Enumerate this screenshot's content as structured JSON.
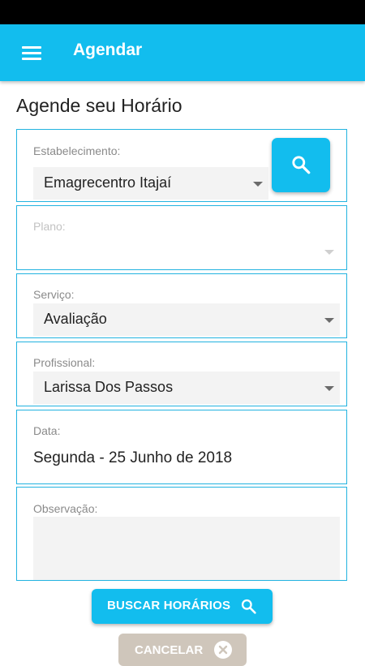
{
  "appbar": {
    "title": "Agendar",
    "menu_icon": "menu-icon"
  },
  "page": {
    "title": "Agende seu Horário"
  },
  "form": {
    "estabelecimento": {
      "label": "Estabelecimento:",
      "value": "Emagrecentro Itajaí"
    },
    "plano": {
      "label": "Plano:",
      "value": ""
    },
    "servico": {
      "label": "Serviço:",
      "value": "Avaliação"
    },
    "profissional": {
      "label": "Profissional:",
      "value": "Larissa Dos Passos"
    },
    "data": {
      "label": "Data:",
      "value": "Segunda - 25 Junho de 2018"
    },
    "observacao": {
      "label": "Observação:",
      "value": ""
    }
  },
  "buttons": {
    "buscar": "BUSCAR HORÁRIOS",
    "cancelar": "CANCELAR"
  },
  "colors": {
    "accent": "#12bdee",
    "border": "#22b3e0",
    "cancel": "#cfc6bb"
  }
}
